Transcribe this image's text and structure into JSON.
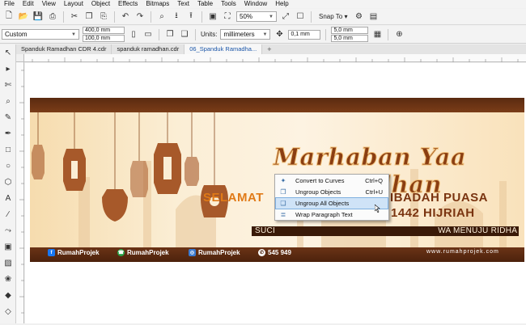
{
  "menu": [
    "File",
    "Edit",
    "View",
    "Layout",
    "Object",
    "Effects",
    "Bitmaps",
    "Text",
    "Table",
    "Tools",
    "Window",
    "Help"
  ],
  "toolbar": {
    "zoom": "50%",
    "snap_to": "Snap To",
    "icons": [
      "new-icon",
      "open-icon",
      "save-icon",
      "cut-icon",
      "copy-icon",
      "paste-icon",
      "undo-icon",
      "redo-icon",
      "import-icon",
      "export-icon",
      "full-screen-icon",
      "settings-icon"
    ]
  },
  "propbar": {
    "preset": "Custom",
    "width": "400,0 mm",
    "height": "100,0 mm",
    "units_label": "Units:",
    "units": "millimeters",
    "nudge": "0,1 mm",
    "dup_x": "5,0 mm",
    "dup_y": "5,0 mm"
  },
  "tabs": [
    {
      "label": "Spanduk Ramadhan CDR 4.cdr",
      "active": false
    },
    {
      "label": "spanduk ramadhan.cdr",
      "active": false
    },
    {
      "label": "06_Spanduk Ramadha...",
      "active": true
    }
  ],
  "banner": {
    "headline": "Marhaban Yaa Ramadhan",
    "line1_left": "SELAMAT",
    "line1_right": "IBADAH PUASA",
    "line2": "N 1442 HIJRIAH",
    "line3": "SUCI",
    "line3_right": "WA MENUJU RIDHA ILAHI",
    "socials": [
      {
        "icon": "facebook-icon",
        "label": "RumahProjek",
        "color": "#1877f2"
      },
      {
        "icon": "whatsapp-icon",
        "label": "RumahProjek",
        "color": "#25a244"
      },
      {
        "icon": "instagram-icon",
        "label": "RumahProjek",
        "color": "#3b7bd1"
      },
      {
        "icon": "phone-icon",
        "label": "545 949",
        "color": "#333333"
      }
    ],
    "website": "www.rumahprojek.com",
    "colors": {
      "dark_brown": "#5a2a10",
      "orange": "#e07a17",
      "cream": "#fbeed5"
    }
  },
  "context_menu": {
    "items": [
      {
        "icon": "convert-curves-icon",
        "label": "Convert to Curves",
        "mnemonic": "v",
        "shortcut": "Ctrl+Q",
        "highlighted": false
      },
      {
        "icon": "ungroup-icon",
        "label": "Ungroup Objects",
        "mnemonic": "U",
        "shortcut": "Ctrl+U",
        "highlighted": false
      },
      {
        "icon": "ungroup-all-icon",
        "label": "Ungroup All Objects",
        "mnemonic": "U",
        "shortcut": "",
        "highlighted": true
      },
      {
        "icon": "wrap-text-icon",
        "label": "Wrap Paragraph Text",
        "mnemonic": "W",
        "shortcut": "",
        "highlighted": false
      }
    ]
  }
}
